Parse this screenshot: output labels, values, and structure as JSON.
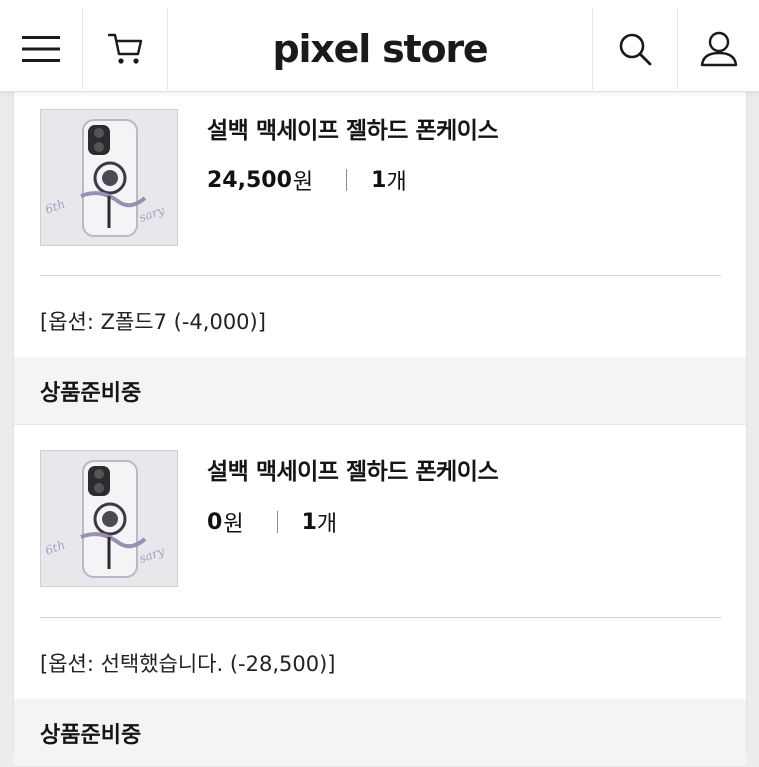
{
  "header": {
    "logo": "pixel store",
    "icons": [
      "menu-icon",
      "cart-icon",
      "search-icon",
      "user-icon"
    ]
  },
  "orders": [
    {
      "product_name": "설백 맥세이프 젤하드 폰케이스",
      "price_amount": "24,500",
      "price_unit": "원",
      "qty_amount": "1",
      "qty_unit": "개",
      "option": "[옵션: Z폴드7 (-4,000)]",
      "status": "상품준비중"
    },
    {
      "product_name": "설백 맥세이프 젤하드 폰케이스",
      "price_amount": "0",
      "price_unit": "원",
      "qty_amount": "1",
      "qty_unit": "개",
      "option": "[옵션: 선택했습니다. (-28,500)]",
      "status": "상품준비중"
    }
  ],
  "colors": {
    "background": "#ececec",
    "panel": "#ffffff",
    "status_bar": "#f4f4f4",
    "text": "#151515"
  }
}
